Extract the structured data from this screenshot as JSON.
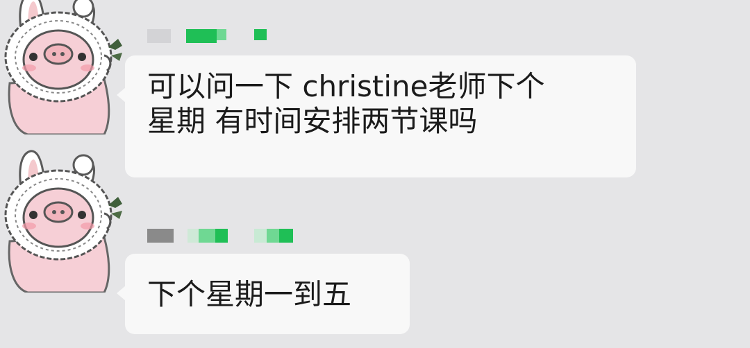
{
  "chat": {
    "messages": [
      {
        "text": "可以问一下 christine老师下个\n星期 有时间安排两节课吗"
      },
      {
        "text": "下个星期一到五"
      }
    ]
  },
  "avatar": {
    "icon": "pig-bunny-avatar-icon"
  },
  "colors": {
    "background": "#e5e5e7",
    "bubble": "#f8f8f8",
    "text": "#1b1b1b",
    "redacted_green": "#1fbf56",
    "redacted_gray": "#8a8a8a"
  }
}
